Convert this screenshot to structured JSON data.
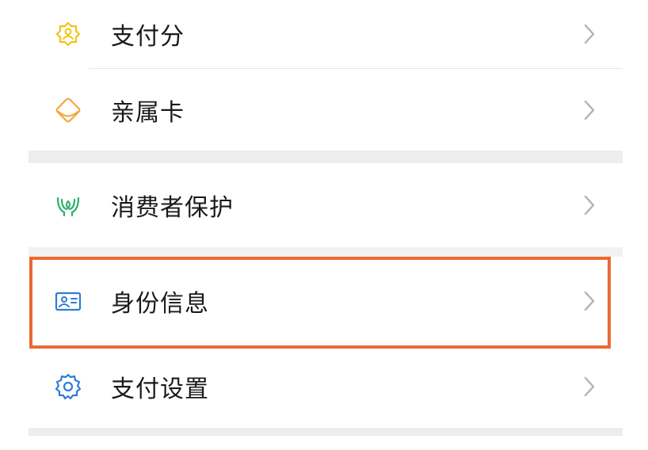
{
  "menu": {
    "items": [
      {
        "label": "支付分",
        "icon": "pay-score-badge-icon"
      },
      {
        "label": "亲属卡",
        "icon": "family-card-icon"
      },
      {
        "label": "消费者保护",
        "icon": "consumer-protection-hands-icon"
      },
      {
        "label": "身份信息",
        "icon": "id-card-icon"
      },
      {
        "label": "支付设置",
        "icon": "gear-icon"
      }
    ]
  },
  "colors": {
    "separator": "#ededed",
    "divider": "#e6e6e6",
    "highlight_border": "#ea6a32",
    "icon_yellow": "#f5c211",
    "icon_orange": "#f4a742",
    "icon_green": "#2fae6a",
    "icon_blue": "#2f7cd6",
    "chevron": "#b2b2b2"
  }
}
